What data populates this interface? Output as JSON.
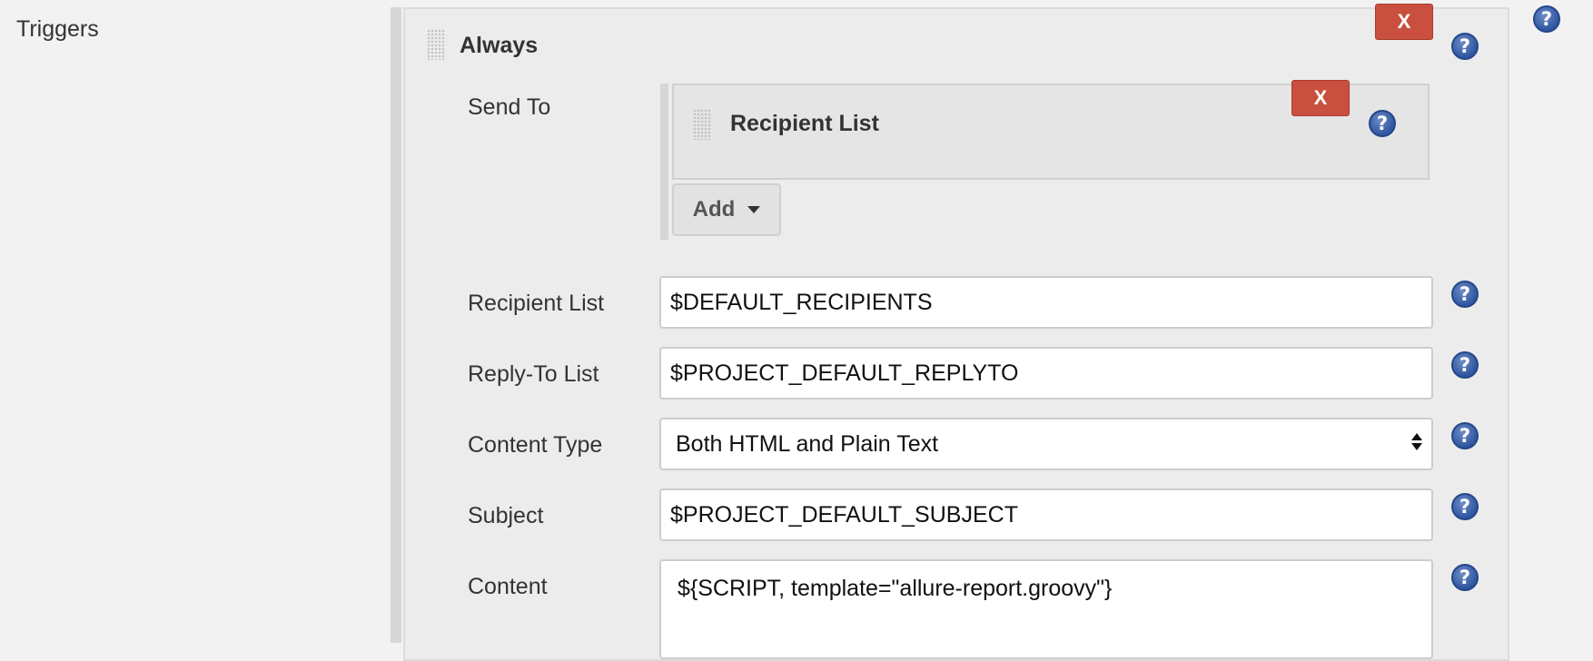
{
  "section": {
    "label": "Triggers"
  },
  "trigger": {
    "title": "Always",
    "delete_label": "X",
    "send_to": {
      "label": "Send To",
      "recipient_card": {
        "title": "Recipient List",
        "delete_label": "X"
      },
      "add_button": {
        "label": "Add"
      }
    },
    "fields": {
      "recipient_list": {
        "label": "Recipient List",
        "value": "$DEFAULT_RECIPIENTS"
      },
      "reply_to_list": {
        "label": "Reply-To List",
        "value": "$PROJECT_DEFAULT_REPLYTO"
      },
      "content_type": {
        "label": "Content Type",
        "selected": "Both HTML and Plain Text"
      },
      "subject": {
        "label": "Subject",
        "value": "$PROJECT_DEFAULT_SUBJECT"
      },
      "content": {
        "label": "Content",
        "value": "${SCRIPT, template=\"allure-report.groovy\"}"
      }
    }
  },
  "icons": {
    "help": "help-icon",
    "drag": "drag-handle-icon",
    "dropdown": "chevron-down-icon"
  },
  "help_glyph": "?",
  "colors": {
    "delete_button": "#c9503f",
    "help_icon": "#2f56a0",
    "background": "#f2f2f2"
  }
}
